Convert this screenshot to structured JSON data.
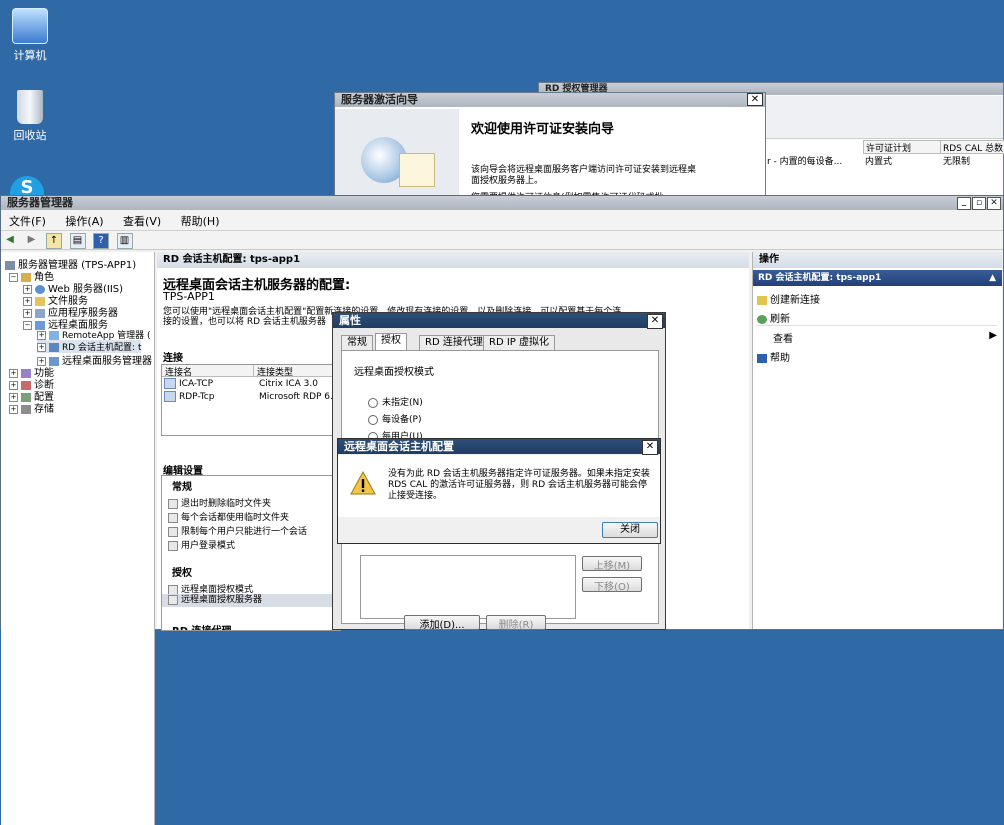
{
  "desktop": {
    "icons": [
      {
        "label": "计算机"
      },
      {
        "label": "回收站"
      }
    ]
  },
  "bg_window": {
    "title": "RD 授权管理器",
    "columns": [
      "许可证计划",
      "RDS CAL 总数"
    ],
    "row": {
      "name": "r - 内置的每设备...",
      "plan": "内置式",
      "total": "无限制"
    }
  },
  "wizard": {
    "title": "服务器激活向导",
    "heading": "欢迎使用许可证安装向导",
    "para1": "该向导会将远程桌面服务客户端访问许可证安装到远程桌面授权服务器上。",
    "para2": "您需要提供许可证信息(例如零售许可证代码或批"
  },
  "server_manager": {
    "title": "服务器管理器",
    "menu": [
      "文件(F)",
      "操作(A)",
      "查看(V)",
      "帮助(H)"
    ],
    "tree": [
      {
        "label": "服务器管理器 (TPS-APP1)",
        "expander": ""
      },
      {
        "label": "角色",
        "expander": "−"
      },
      {
        "label": "Web 服务器(IIS)",
        "expander": "+"
      },
      {
        "label": "文件服务",
        "expander": "+"
      },
      {
        "label": "应用程序服务器",
        "expander": "+"
      },
      {
        "label": "远程桌面服务",
        "expander": "−"
      },
      {
        "label": "RemoteApp 管理器 (",
        "expander": "+"
      },
      {
        "label": "RD 会话主机配置: t",
        "expander": "+"
      },
      {
        "label": "远程桌面服务管理器",
        "expander": "+"
      },
      {
        "label": "功能",
        "expander": "+"
      },
      {
        "label": "诊断",
        "expander": "+"
      },
      {
        "label": "配置",
        "expander": "+"
      },
      {
        "label": "存储",
        "expander": "+"
      }
    ],
    "center": {
      "header": "RD 会话主机配置: tps-app1",
      "heading": "远程桌面会话主机服务器的配置:",
      "server": "TPS-APP1",
      "desc1": "您可以使用\"远程桌面会话主机配置\"配置新连接的设置、修改现有连接的设置，以及删除连接。可以配置基于每个连",
      "desc2": "接的设置，也可以将 RD 会话主机服务器",
      "connections_label": "连接",
      "conn_columns": [
        "连接名",
        "连接类型"
      ],
      "connections": [
        {
          "name": "ICA-TCP",
          "type": "Citrix ICA 3.0"
        },
        {
          "name": "RDP-Tcp",
          "type": "Microsoft RDP 6."
        }
      ],
      "edit_label": "编辑设置",
      "general_label": "常规",
      "general_items": [
        "退出时删除临时文件夹",
        "每个会话都使用临时文件夹",
        "限制每个用户只能进行一个会话",
        "用户登录模式"
      ],
      "licensing_label": "授权",
      "licensing_items": [
        "远程桌面授权模式",
        "远程桌面授权服务器"
      ],
      "rd_conn_label": "RD 连接代理"
    },
    "actions": {
      "header": "操作",
      "subheader": "RD 会话主机配置: tps-app1",
      "items": [
        {
          "label": "创建新连接",
          "icon": "new-connection-icon"
        },
        {
          "label": "刷新",
          "icon": "refresh-icon"
        },
        {
          "label": "查看",
          "icon": ""
        },
        {
          "label": "帮助",
          "icon": "help-icon"
        }
      ]
    }
  },
  "properties": {
    "title": "属性",
    "tabs": [
      "常规",
      "授权",
      "RD 连接代理",
      "RD IP 虚拟化"
    ],
    "active_tab": "授权",
    "mode_label": "远程桌面授权模式",
    "radios": [
      "未指定(N)",
      "每设备(P)",
      "每用户(U)"
    ],
    "buttons": {
      "up": "上移(M)",
      "down": "下移(O)",
      "add": "添加(D)...",
      "remove": "删除(R)"
    }
  },
  "alert": {
    "title": "远程桌面会话主机配置",
    "message": "没有为此 RD 会话主机服务器指定许可证服务器。如果未指定安装 RDS CAL 的激活许可证服务器，则 RD 会话主机服务器可能会停止接受连接。",
    "close": "关闭"
  },
  "colors": {
    "desktop": "#2f6aa6",
    "title_dark": "#1f3d63",
    "selected": "#cfd8e6",
    "action_header": "#24427a"
  }
}
